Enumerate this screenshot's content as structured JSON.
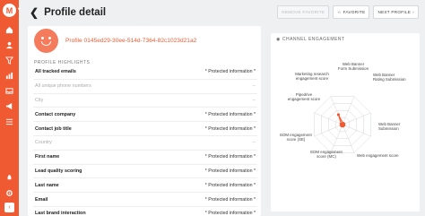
{
  "sidebar": {
    "logo_letter": "M"
  },
  "header": {
    "title": "Profile detail",
    "actions": {
      "remove_favorite": "REMOVE FAVORITE",
      "favorite": "FAVORITE",
      "next_profile": "NEXT PROFILE"
    }
  },
  "profile": {
    "id": "Profile 0145ed29-30ee-514d-7364-82c1023d21a2",
    "section_label": "PROFILE HIGHLIGHTS",
    "rows": [
      {
        "label": "All tracked emails",
        "value": "* Protected information *",
        "muted": false
      },
      {
        "label": "All unique phone numbers",
        "value": "--",
        "muted": true
      },
      {
        "label": "City",
        "value": "--",
        "muted": true
      },
      {
        "label": "Contact company",
        "value": "* Protected information *",
        "muted": false
      },
      {
        "label": "Contact job title",
        "value": "* Protected information *",
        "muted": false
      },
      {
        "label": "Country",
        "value": "--",
        "muted": true
      },
      {
        "label": "First name",
        "value": "* Protected information *",
        "muted": false
      },
      {
        "label": "Lead quality scoring",
        "value": "* Protected information *",
        "muted": false
      },
      {
        "label": "Last name",
        "value": "* Protected information *",
        "muted": false
      },
      {
        "label": "Email",
        "value": "* Protected information *",
        "muted": false
      },
      {
        "label": "Last brand interaction",
        "value": "* Protected information *",
        "muted": false
      }
    ]
  },
  "channel": {
    "title": "CHANNEL ENGAGEMENT",
    "axes": [
      "Web Banner Form Submission",
      "Web Banner Rating Submission",
      "Web Banner Submission",
      "Web engagement score",
      "EDM engagement score (MC)",
      "EDM engagement score (SE)",
      "Pipedrive engagement score",
      "Marketing research engagement score"
    ],
    "values": [
      0.05,
      0.05,
      0.05,
      0.05,
      0.05,
      0.05,
      0.05,
      0.35
    ],
    "accent": "#f05a32"
  }
}
